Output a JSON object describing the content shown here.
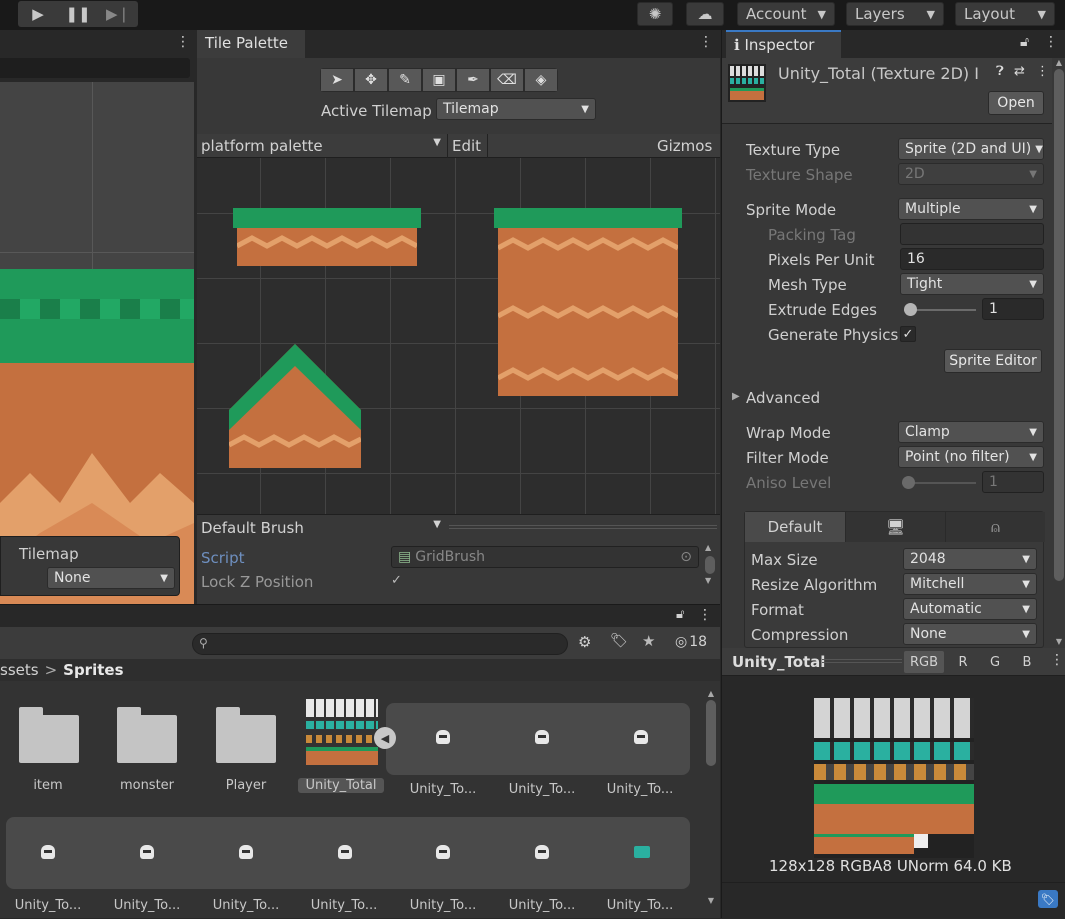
{
  "toolbar": {
    "play_icon": "play-icon",
    "pause_icon": "pause-icon",
    "step_icon": "step-icon",
    "account": "Account",
    "layers": "Layers",
    "layout": "Layout"
  },
  "scene": {
    "tilemap_label": "Tilemap",
    "tilemap_value": "None"
  },
  "tile_palette": {
    "tab": "Tile Palette",
    "active_tilemap_label": "Active Tilemap",
    "active_tilemap_value": "Tilemap",
    "palette_value": "platform palette",
    "edit": "Edit",
    "gizmos": "Gizmos",
    "brush": "Default Brush",
    "script_label": "Script",
    "script_value": "GridBrush",
    "lock_z_label": "Lock Z Position"
  },
  "inspector": {
    "tab": "Inspector",
    "title": "Unity_Total (Texture 2D) I",
    "open": "Open",
    "texture_type_label": "Texture Type",
    "texture_type_value": "Sprite (2D and UI)",
    "texture_shape_label": "Texture Shape",
    "texture_shape_value": "2D",
    "sprite_mode_label": "Sprite Mode",
    "sprite_mode_value": "Multiple",
    "packing_tag_label": "Packing Tag",
    "ppu_label": "Pixels Per Unit",
    "ppu_value": "16",
    "mesh_type_label": "Mesh Type",
    "mesh_type_value": "Tight",
    "extrude_label": "Extrude Edges",
    "extrude_value": "1",
    "gen_physics_label": "Generate Physics",
    "sprite_editor": "Sprite Editor",
    "advanced": "Advanced",
    "wrap_label": "Wrap Mode",
    "wrap_value": "Clamp",
    "filter_label": "Filter Mode",
    "filter_value": "Point (no filter)",
    "aniso_label": "Aniso Level",
    "aniso_value": "1",
    "platform_tab_default": "Default",
    "max_size_label": "Max Size",
    "max_size_value": "2048",
    "resize_label": "Resize Algorithm",
    "resize_value": "Mitchell",
    "format_label": "Format",
    "format_value": "Automatic",
    "compression_label": "Compression",
    "compression_value": "None"
  },
  "preview": {
    "name": "Unity_Total",
    "channels": [
      "RGB",
      "R",
      "G",
      "B"
    ],
    "info": "128x128  RGBA8 UNorm   64.0 KB"
  },
  "project": {
    "hidden_count": "18",
    "breadcrumb_root": "ssets",
    "breadcrumb_sep": ">",
    "breadcrumb_current": "Sprites",
    "folders": [
      "item",
      "monster",
      "Player"
    ],
    "texture": "Unity_Total",
    "sprite_label": "Unity_To..."
  },
  "colors": {
    "grass": "#1f9a5a",
    "dirt": "#c4703f",
    "dirt_light": "#e3a06a",
    "accent": "#3a79c4"
  }
}
